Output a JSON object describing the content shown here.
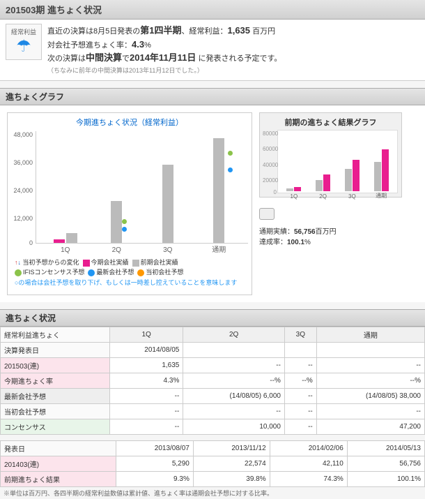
{
  "header": {
    "title": "201503期 進ちょく状況"
  },
  "info": {
    "icon_label": "経常利益",
    "line1_a": "直近の決算は8月5日発表の",
    "line1_b": "第1四半期",
    "line1_c": "、経常利益：",
    "line1_val": "1,635",
    "line1_unit": " 百万円",
    "line2_a": "対会社予想進ちょく率：",
    "line2_val": "4.3",
    "line2_unit": "%",
    "line3_a": "次の決算は",
    "line3_b": "中間決算",
    "line3_c": "で",
    "line3_d": "2014年11月11日",
    "line3_e": " に発表される予定です。",
    "line4": "（ちなみに前年の中間決算は2013年11月12日でした。）"
  },
  "graph_section": "進ちょくグラフ",
  "chart": {
    "title": "今期進ちょく状況（経常利益）",
    "ylabels": [
      "48,000",
      "36,000",
      "24,000",
      "12,000",
      "0"
    ],
    "xlabels": [
      "1Q",
      "2Q",
      "3Q",
      "通期"
    ]
  },
  "legend": {
    "arrows": "当初予想からの変化",
    "cur": "今期会社実績",
    "prev": "前期会社実績",
    "ifis": "IFISコンセンサス予想",
    "latest": "最新会社予想",
    "initial": "当初会社予想",
    "note": "○の場合は会社予想を取り下げ、もしくは一時差し控えていることを意味します"
  },
  "side": {
    "title": "前期の進ちょく結果グラフ",
    "ylabels": [
      "80000",
      "60000",
      "40000",
      "20000",
      "0"
    ],
    "xlabels": [
      "1Q",
      "2Q",
      "3Q",
      "通期"
    ],
    "stat1_l": "通期実績：",
    "stat1_v": "56,756",
    "stat1_u": "百万円",
    "stat2_l": "達成率：",
    "stat2_v": "100.1",
    "stat2_u": "%"
  },
  "table_section": "進ちょく状況",
  "t1": {
    "h": [
      "経常利益進ちょく",
      "1Q",
      "2Q",
      "3Q",
      "通期"
    ],
    "r1": [
      "決算発表日",
      "2014/08/05",
      "",
      "",
      ""
    ],
    "r2": [
      "201503(連)",
      "1,635",
      "--",
      "--",
      "--"
    ],
    "r3": [
      "今期進ちょく率",
      "4.3%",
      "--%",
      "--%",
      "--%"
    ],
    "r4": [
      "最新会社予想",
      "--",
      "(14/08/05) 6,000",
      "--",
      "(14/08/05) 38,000"
    ],
    "r5": [
      "当初会社予想",
      "--",
      "--",
      "--",
      "--"
    ],
    "r6": [
      "コンセンサス",
      "--",
      "10,000",
      "--",
      "47,200"
    ]
  },
  "t2": {
    "r1": [
      "発表日",
      "2013/08/07",
      "2013/11/12",
      "2014/02/06",
      "2014/05/13"
    ],
    "r2": [
      "201403(連)",
      "5,290",
      "22,574",
      "42,110",
      "56,756"
    ],
    "r3": [
      "前期進ちょく結果",
      "9.3%",
      "39.8%",
      "74.3%",
      "100.1%"
    ]
  },
  "footnote": "※単位は百万円、各四半期の経常利益数値は累計値、進ちょく率は通期会社予想に対する比率。",
  "chart_data": {
    "main": {
      "type": "bar",
      "title": "今期進ちょく状況（経常利益）",
      "categories": [
        "1Q",
        "2Q",
        "3Q",
        "通期"
      ],
      "series": [
        {
          "name": "今期会社実績",
          "values": [
            1635,
            null,
            null,
            null
          ]
        },
        {
          "name": "前期会社実績",
          "values": [
            5290,
            22574,
            42110,
            56756
          ]
        }
      ],
      "points": [
        {
          "name": "IFISコンセンサス予想",
          "cat": "2Q",
          "value": 10000
        },
        {
          "name": "最新会社予想",
          "cat": "2Q",
          "value": 6000
        },
        {
          "name": "IFISコンセンサス予想",
          "cat": "通期",
          "value": 47200
        },
        {
          "name": "最新会社予想",
          "cat": "通期",
          "value": 38000
        }
      ],
      "ylabel": "",
      "ylim": [
        0,
        60000
      ]
    },
    "side": {
      "type": "bar",
      "title": "前期の進ちょく結果グラフ",
      "categories": [
        "1Q",
        "2Q",
        "3Q",
        "通期"
      ],
      "series": [
        {
          "name": "前期",
          "values": [
            5290,
            22574,
            42110,
            56756
          ]
        },
        {
          "name": "参考",
          "values": [
            3000,
            15000,
            30000,
            40000
          ]
        }
      ],
      "ylim": [
        0,
        80000
      ]
    }
  }
}
